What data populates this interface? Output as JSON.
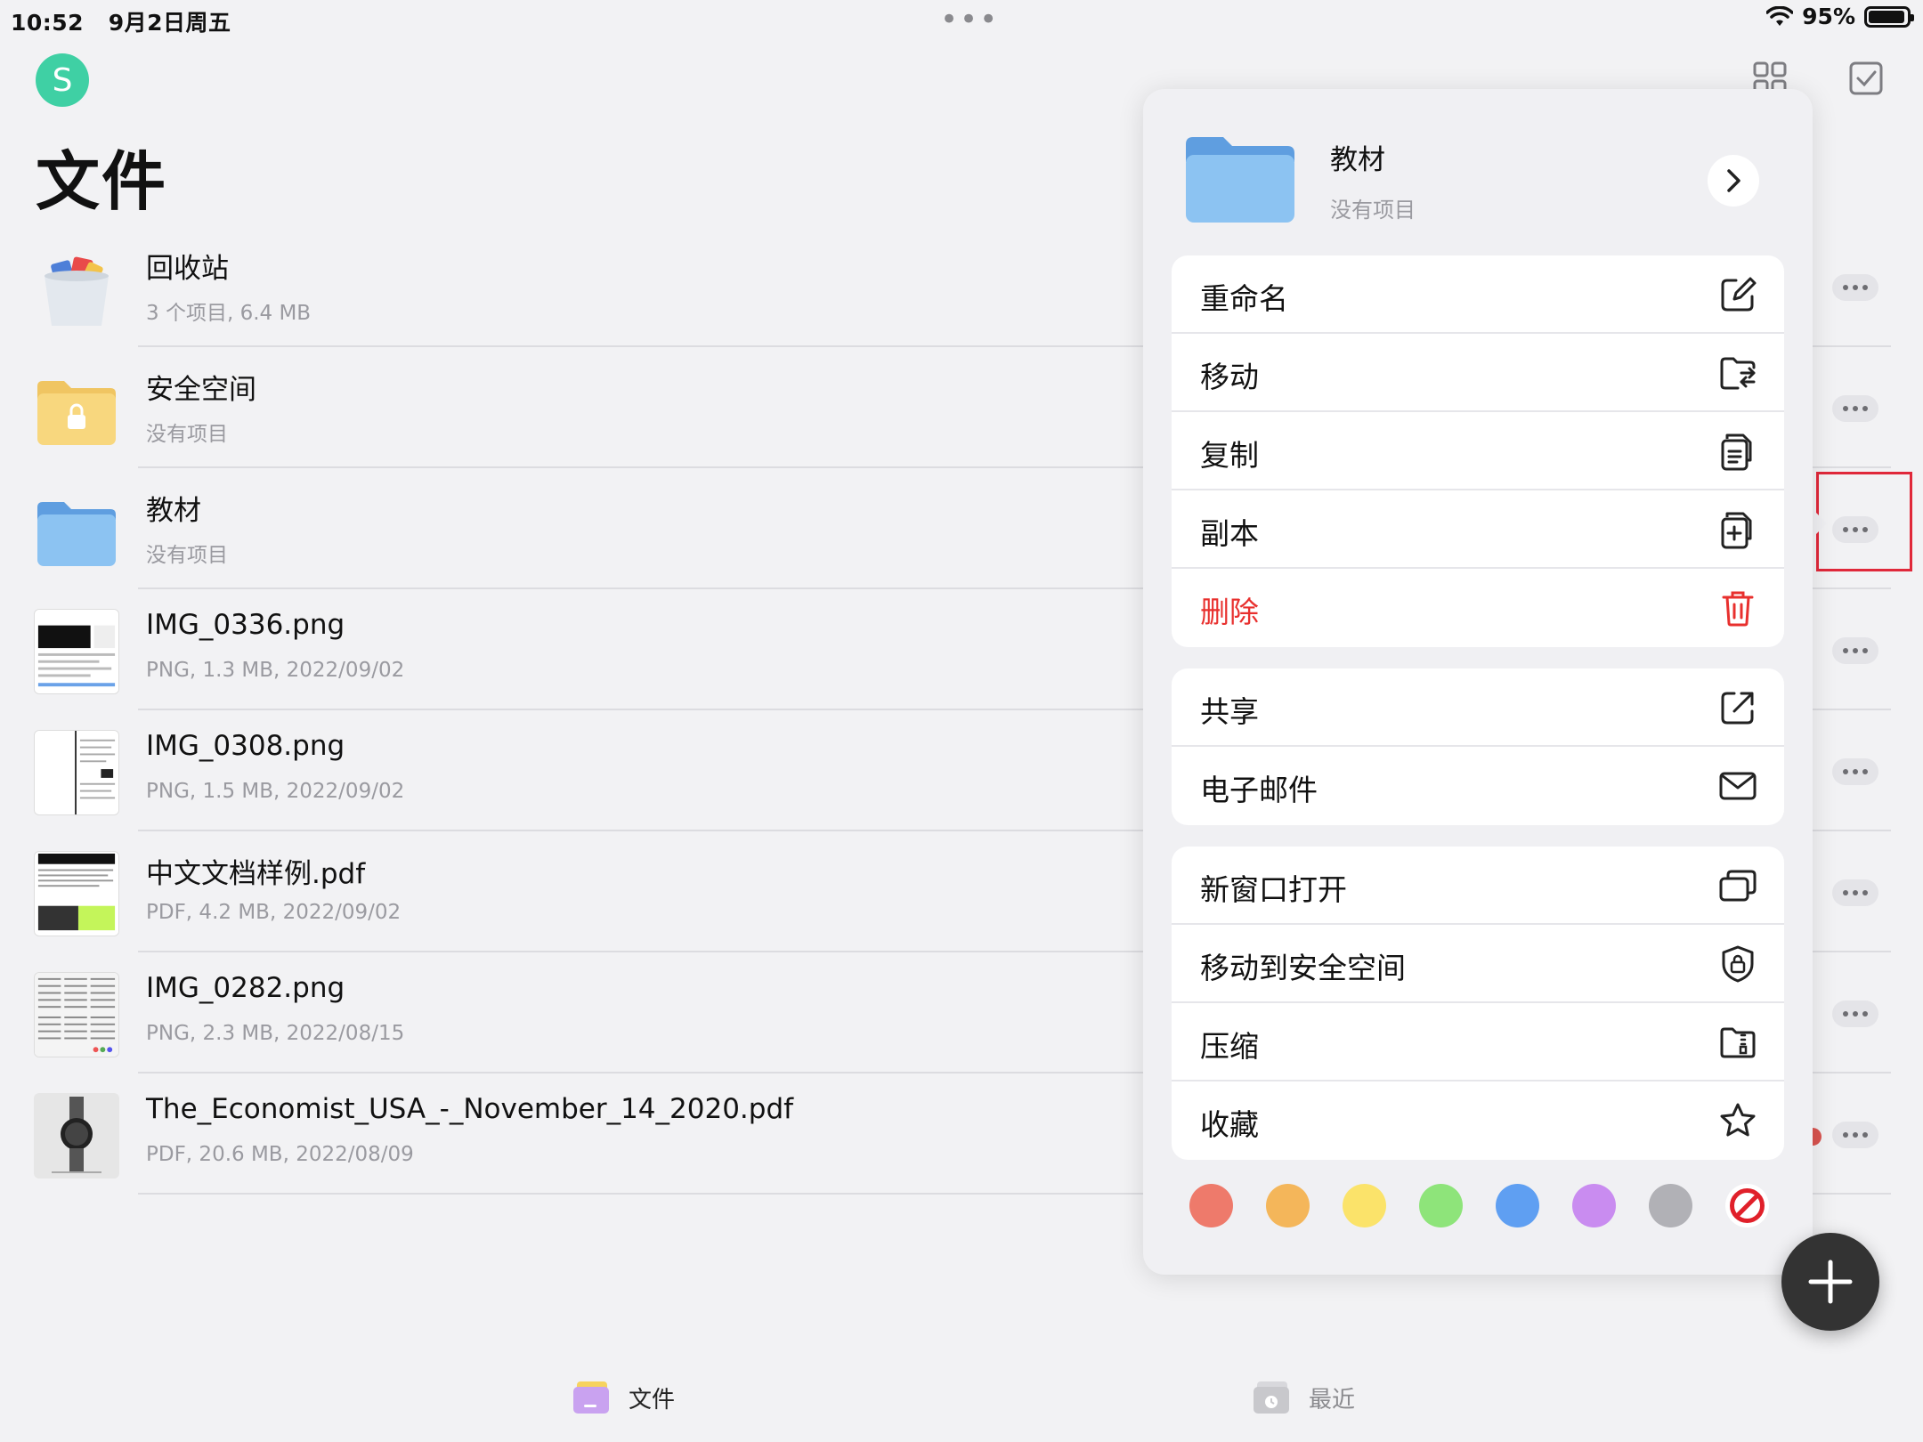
{
  "status": {
    "time": "10:52",
    "date": "9月2日周五",
    "battery": "95%",
    "battery_level": 0.95
  },
  "header": {
    "avatar_letter": "S",
    "title": "文件"
  },
  "files": [
    {
      "name": "回收站",
      "meta": "3 个项目, 6.4 MB",
      "icon": "trash-bin-icon"
    },
    {
      "name": "安全空间",
      "meta": "没有项目",
      "icon": "secure-folder-icon"
    },
    {
      "name": "教材",
      "meta": "没有项目",
      "icon": "folder-icon"
    },
    {
      "name": "IMG_0336.png",
      "meta": "PNG, 1.3 MB, 2022/09/02",
      "icon": "image-thumbnail"
    },
    {
      "name": "IMG_0308.png",
      "meta": "PNG, 1.5 MB, 2022/09/02",
      "icon": "image-thumbnail"
    },
    {
      "name": "中文文档样例.pdf",
      "meta": "PDF, 4.2 MB, 2022/09/02",
      "icon": "pdf-thumbnail"
    },
    {
      "name": "IMG_0282.png",
      "meta": "PNG, 2.3 MB, 2022/08/15",
      "icon": "image-thumbnail"
    },
    {
      "name": "The_Economist_USA_-_November_14_2020.pdf",
      "meta": "PDF, 20.6 MB, 2022/08/09",
      "icon": "pdf-thumbnail",
      "tag_color": "#d9534f"
    }
  ],
  "popover": {
    "folder_name": "教材",
    "folder_meta": "没有项目",
    "groups": [
      [
        {
          "label": "重命名",
          "icon": "rename-icon"
        },
        {
          "label": "移动",
          "icon": "move-folder-icon"
        },
        {
          "label": "复制",
          "icon": "copy-icon"
        },
        {
          "label": "副本",
          "icon": "duplicate-icon"
        },
        {
          "label": "删除",
          "icon": "trash-icon",
          "danger": true
        }
      ],
      [
        {
          "label": "共享",
          "icon": "share-icon"
        },
        {
          "label": "电子邮件",
          "icon": "mail-icon"
        }
      ],
      [
        {
          "label": "新窗口打开",
          "icon": "new-window-icon"
        },
        {
          "label": "移动到安全空间",
          "icon": "shield-lock-icon"
        },
        {
          "label": "压缩",
          "icon": "zip-folder-icon"
        },
        {
          "label": "收藏",
          "icon": "star-icon"
        }
      ]
    ],
    "tag_colors": [
      "#ee7a6b",
      "#f4b65a",
      "#fbe36a",
      "#8ee47a",
      "#5f9ff2",
      "#c98cf0",
      "#b1b1b6"
    ]
  },
  "tabbar": {
    "files_label": "文件",
    "recent_label": "最近"
  },
  "colors": {
    "accent": "#3fd0a4",
    "danger": "#e8302e",
    "folder_blue": "#7ab4ec"
  }
}
